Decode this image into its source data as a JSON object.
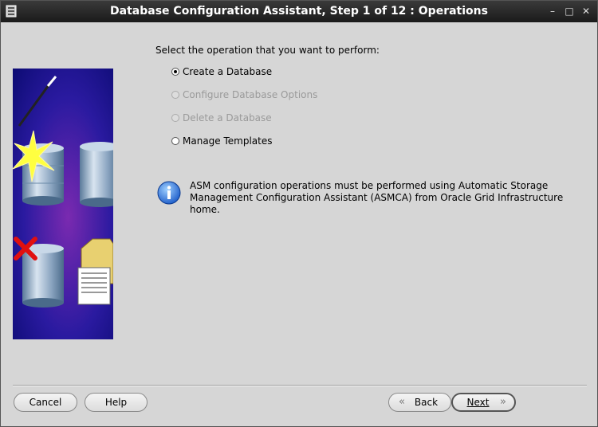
{
  "window": {
    "title": "Database Configuration Assistant, Step 1 of 12 : Operations"
  },
  "prompt": "Select the operation that you want to perform:",
  "options": [
    {
      "label": "Create a Database",
      "selected": true,
      "enabled": true
    },
    {
      "label": "Configure Database Options",
      "selected": false,
      "enabled": false
    },
    {
      "label": "Delete a Database",
      "selected": false,
      "enabled": false
    },
    {
      "label": "Manage Templates",
      "selected": false,
      "enabled": true
    }
  ],
  "info": {
    "line1": "ASM configuration operations must be performed using Automatic Storage",
    "line2": "Management Configuration Assistant (ASMCA) from Oracle Grid Infrastructure home."
  },
  "buttons": {
    "cancel": "Cancel",
    "help": "Help",
    "back": "Back",
    "next": "Next"
  },
  "icons": {
    "window_controls": [
      "minimize-icon",
      "maximize-icon",
      "close-icon"
    ],
    "info": "info-icon",
    "back_arrow": "chevron-left-icon",
    "next_arrow": "chevron-right-icon"
  },
  "colors": {
    "titlebar": "#1a1a1a",
    "window_bg": "#d6d6d6",
    "banner_bg": "#1a1a8a",
    "info_icon": "#2a6fd6"
  }
}
